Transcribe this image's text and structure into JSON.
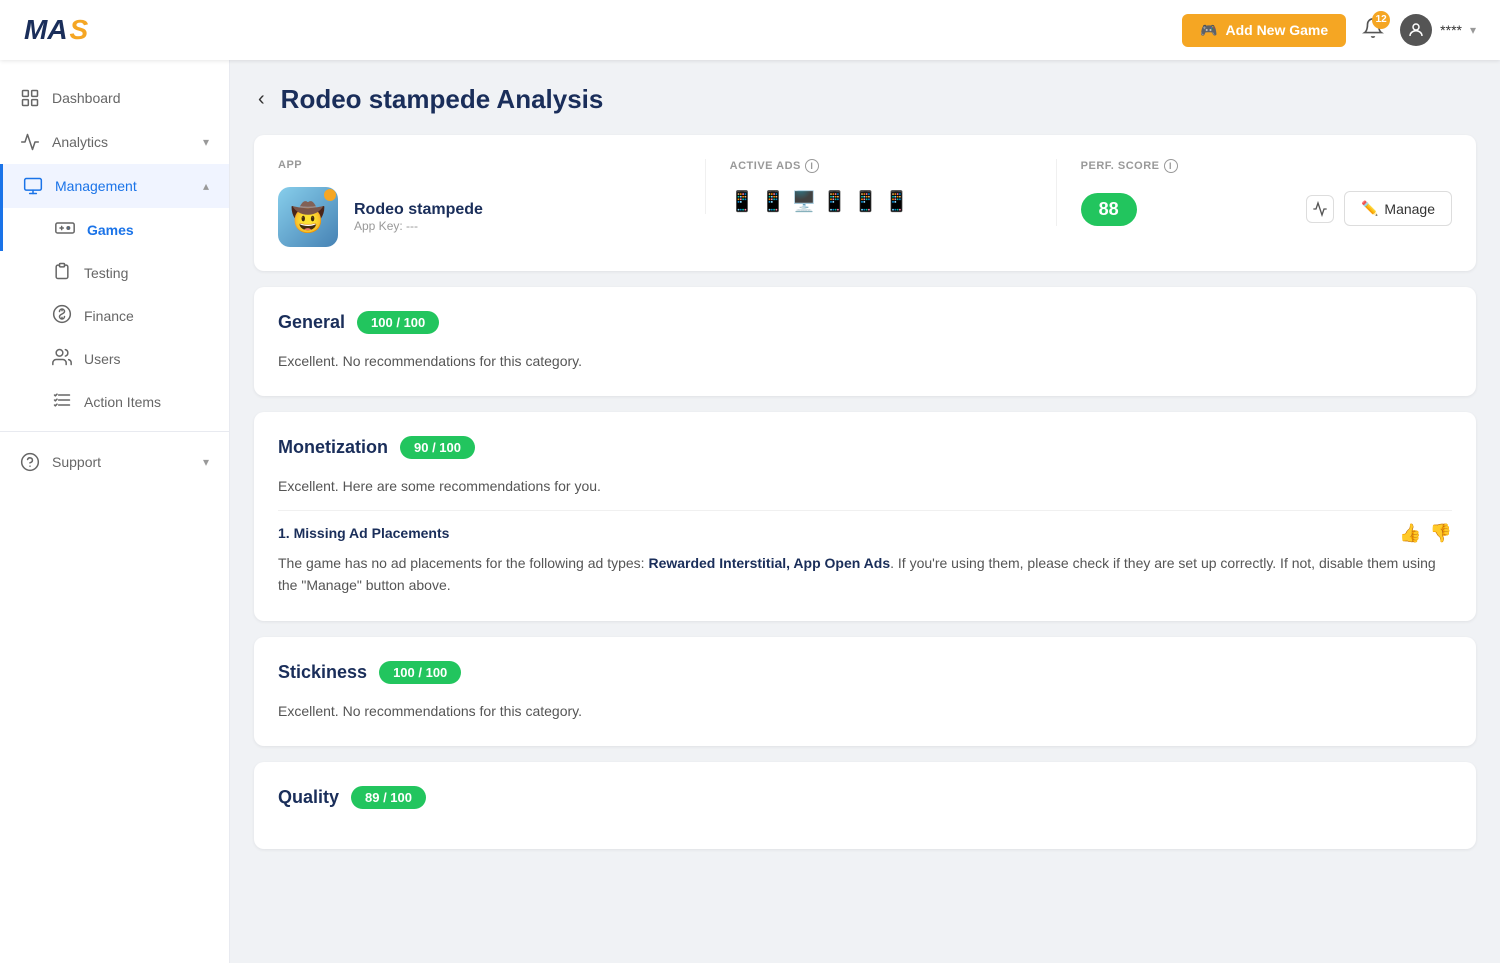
{
  "header": {
    "logo_m": "MA",
    "logo_s": "S",
    "add_game_label": "Add New Game",
    "notif_count": "12",
    "user_display": "****",
    "chevron": "▾"
  },
  "sidebar": {
    "items": [
      {
        "id": "dashboard",
        "label": "Dashboard",
        "icon": "dashboard"
      },
      {
        "id": "analytics",
        "label": "Analytics",
        "icon": "analytics",
        "expandable": true
      },
      {
        "id": "management",
        "label": "Management",
        "icon": "management",
        "expandable": true,
        "active": true,
        "expanded": true
      },
      {
        "id": "games",
        "label": "Games",
        "icon": "games",
        "sub": true,
        "active": true
      },
      {
        "id": "testing",
        "label": "Testing",
        "icon": "testing",
        "sub": true
      },
      {
        "id": "finance",
        "label": "Finance",
        "icon": "finance",
        "sub": true
      },
      {
        "id": "users",
        "label": "Users",
        "icon": "users",
        "sub": true
      },
      {
        "id": "action-items",
        "label": "Action Items",
        "icon": "action-items",
        "sub": true
      },
      {
        "id": "support",
        "label": "Support",
        "icon": "support",
        "expandable": true
      }
    ]
  },
  "page": {
    "title": "Rodeo stampede Analysis",
    "back_label": "‹"
  },
  "app_card": {
    "col_app": "APP",
    "col_ads": "ACTIVE ADS",
    "col_score": "PERF. SCORE",
    "app_name": "Rodeo stampede",
    "app_key_label": "App Key: ---",
    "perf_score": "88",
    "manage_label": "Manage"
  },
  "sections": [
    {
      "id": "general",
      "title": "General",
      "score": "100 / 100",
      "score_class": "green",
      "desc": "Excellent. No recommendations for this category.",
      "recommendations": []
    },
    {
      "id": "monetization",
      "title": "Monetization",
      "score": "90 / 100",
      "score_class": "green",
      "desc": "Excellent. Here are some recommendations for you.",
      "recommendations": [
        {
          "title": "1. Missing Ad Placements",
          "text_before": "The game has no ad placements for the following ad types: ",
          "text_bold": "Rewarded Interstitial, App Open Ads",
          "text_after": ". If you're using them, please check if they are set up correctly. If not, disable them using the \"Manage\" button above."
        }
      ]
    },
    {
      "id": "stickiness",
      "title": "Stickiness",
      "score": "100 / 100",
      "score_class": "green",
      "desc": "Excellent. No recommendations for this category.",
      "recommendations": []
    },
    {
      "id": "quality",
      "title": "Quality",
      "score": "89 / 100",
      "score_class": "green",
      "desc": "",
      "recommendations": []
    }
  ]
}
